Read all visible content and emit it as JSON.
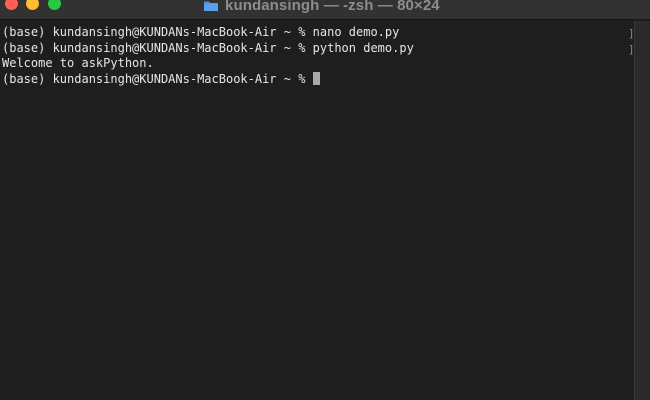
{
  "window": {
    "title": "kundansingh — -zsh — 80×24",
    "folder_icon": "folder-icon"
  },
  "terminal": {
    "lines": [
      "(base) kundansingh@KUNDANs-MacBook-Air ~ % nano demo.py",
      "(base) kundansingh@KUNDANs-MacBook-Air ~ % python demo.py",
      "Welcome to askPython.",
      "(base) kundansingh@KUNDANs-MacBook-Air ~ % "
    ]
  },
  "colors": {
    "background": "#1e1e1e",
    "text": "#e6e6e6",
    "titlebar": "#323232",
    "close": "#fe5f57",
    "minimize": "#febc2e",
    "zoom": "#28c840"
  }
}
